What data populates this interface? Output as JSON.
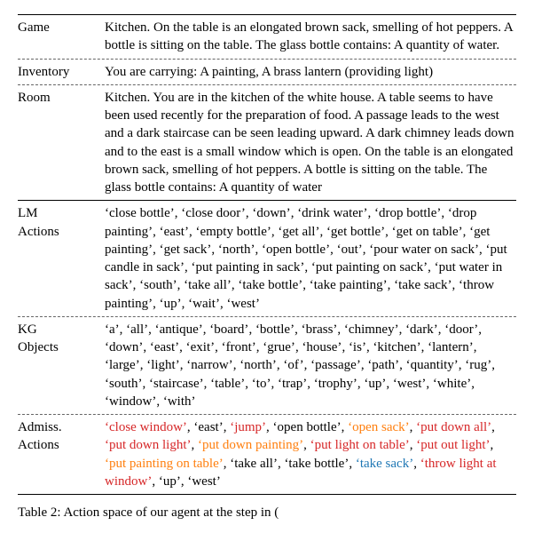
{
  "rows": [
    {
      "label": "Game",
      "text": "Kitchen. On the table is an elongated brown sack, smelling of hot peppers. A bottle is sitting on the table. The glass bottle contains: A quantity of water."
    },
    {
      "label": "Inventory",
      "text": "You are carrying: A painting, A brass lantern (providing light)"
    },
    {
      "label": "Room",
      "text": "Kitchen. You are in the kitchen of the white house. A table seems to have been used recently for the preparation of food. A passage leads to the west and a dark staircase can be seen leading upward. A dark chimney leads down and to the east is a small window which is open. On the table is an elongated brown sack, smelling of hot peppers. A bottle is sitting on the table. The glass bottle contains: A quantity of water"
    }
  ],
  "lm_actions_label": "LM\nActions",
  "lm_actions": [
    "close bottle",
    "close door",
    "down",
    "drink water",
    "drop bottle",
    "drop painting",
    "east",
    "empty bottle",
    "get all",
    "get bottle",
    "get on table",
    "get painting",
    "get sack",
    "north",
    "open bottle",
    "out",
    "pour water on sack",
    "put candle in sack",
    "put painting in sack",
    "put painting on sack",
    "put water in sack",
    "south",
    "take all",
    "take bottle",
    "take painting",
    "take sack",
    "throw painting",
    "up",
    "wait",
    "west"
  ],
  "kg_objects_label": "KG\nObjects",
  "kg_objects": [
    "a",
    "all",
    "antique",
    "board",
    "bottle",
    "brass",
    "chimney",
    "dark",
    "door",
    "down",
    "east",
    "exit",
    "front",
    "grue",
    "house",
    "is",
    "kitchen",
    "lantern",
    "large",
    "light",
    "narrow",
    "north",
    "of",
    "passage",
    "path",
    "quantity",
    "rug",
    "south",
    "staircase",
    "table",
    "to",
    "trap",
    "trophy",
    "up",
    "west",
    "white",
    "window",
    "with"
  ],
  "admiss_label": "Admiss.\nActions",
  "admiss_actions": [
    {
      "t": "close window",
      "c": "red"
    },
    {
      "t": "east"
    },
    {
      "t": "jump",
      "c": "red"
    },
    {
      "t": "open bottle"
    },
    {
      "t": "open sack",
      "c": "orange"
    },
    {
      "t": "put down all",
      "c": "red"
    },
    {
      "t": "put down light",
      "c": "red"
    },
    {
      "t": "put down painting",
      "c": "orange"
    },
    {
      "t": "put light on table",
      "c": "red"
    },
    {
      "t": "put out light",
      "c": "red"
    },
    {
      "t": "put painting on table",
      "c": "orange"
    },
    {
      "t": "take all"
    },
    {
      "t": "take bottle"
    },
    {
      "t": "take sack",
      "c": "blue"
    },
    {
      "t": "throw light at window",
      "c": "red"
    },
    {
      "t": "up"
    },
    {
      "t": "west"
    }
  ],
  "caption_label": "Table 2:",
  "caption_text": " Action space of our agent at the step in ("
}
